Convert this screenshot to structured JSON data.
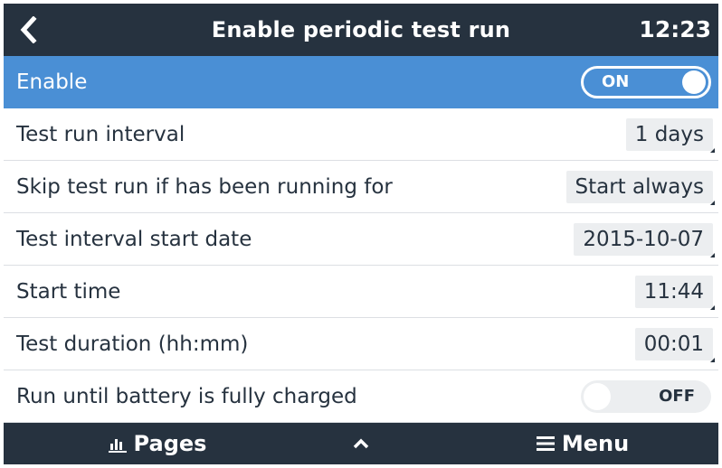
{
  "header": {
    "title": "Enable periodic test run",
    "time": "12:23"
  },
  "rows": [
    {
      "label": "Enable",
      "toggle_label": "ON",
      "state": "on"
    },
    {
      "label": "Test run interval",
      "value": "1 days"
    },
    {
      "label": "Skip test run if has been running for",
      "value": "Start always"
    },
    {
      "label": "Test interval start date",
      "value": "2015-10-07"
    },
    {
      "label": "Start time",
      "value": "11:44"
    },
    {
      "label": "Test duration (hh:mm)",
      "value": "00:01"
    },
    {
      "label": "Run until battery is fully charged",
      "toggle_label": "OFF",
      "state": "off"
    }
  ],
  "footer": {
    "pages_label": "Pages",
    "menu_label": "Menu"
  },
  "colors": {
    "header_bg": "#26323f",
    "selected_row": "#4a8fd5",
    "value_bg": "#eceef0",
    "text": "#26323f"
  },
  "icons": {
    "back": "chevron-left-icon",
    "pages": "bar-chart-icon",
    "up": "chevron-up-icon",
    "menu": "hamburger-icon"
  }
}
